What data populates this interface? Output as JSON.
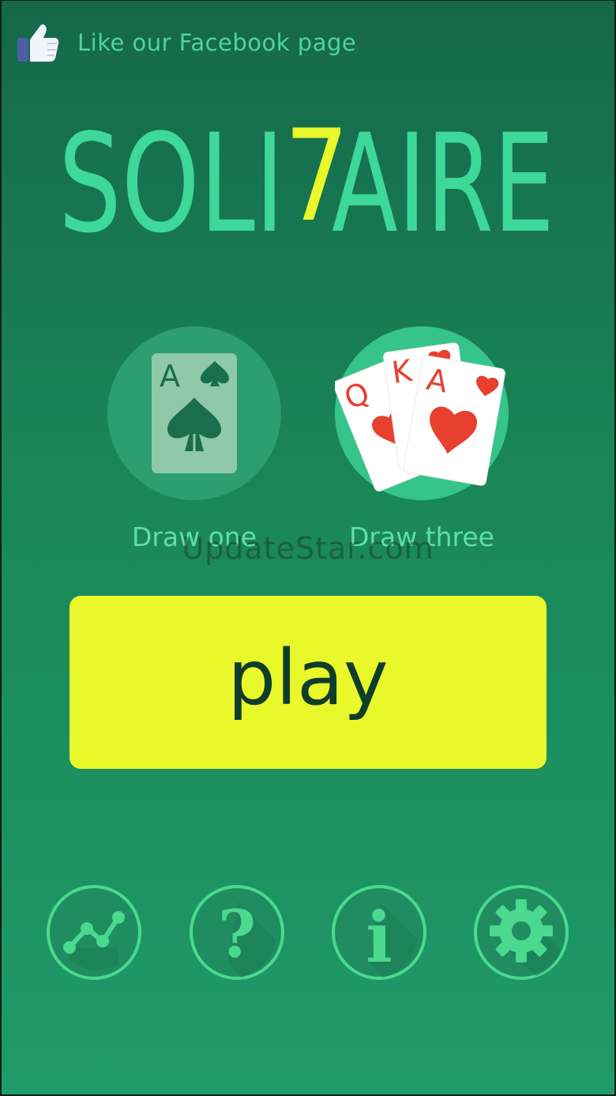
{
  "facebook": {
    "label": "Like our Facebook page",
    "icon": "thumbs-up-icon"
  },
  "logo": {
    "text_left": "SOLI",
    "text_seven": "7",
    "text_right": "AIRE",
    "colors": {
      "letters": "#3ed89a",
      "seven": "#e9f82a"
    }
  },
  "modes": [
    {
      "label": "Draw one",
      "cards": [
        "A"
      ]
    },
    {
      "label": "Draw three",
      "cards": [
        "Q",
        "K",
        "A"
      ]
    }
  ],
  "watermark": "UpdateStar.com",
  "play": {
    "label": "play",
    "color": "#e9f82a"
  },
  "bottom_buttons": [
    {
      "icon": "stats-icon"
    },
    {
      "icon": "help-icon",
      "glyph": "?"
    },
    {
      "icon": "info-icon",
      "glyph": "i"
    },
    {
      "icon": "settings-icon"
    }
  ]
}
